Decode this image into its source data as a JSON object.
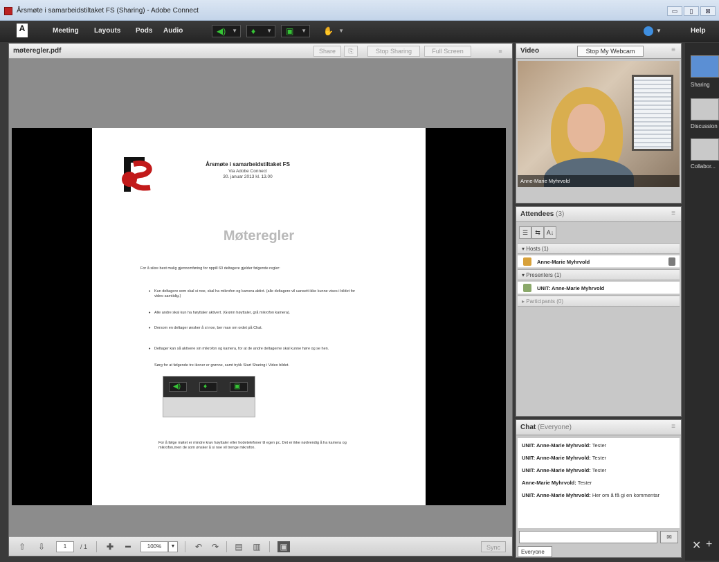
{
  "window": {
    "title": "Årsmøte i samarbeidstiltaket FS (Sharing) - Adobe Connect",
    "btn_min": "▭",
    "btn_max": "▯",
    "btn_close": "⊠"
  },
  "menu": {
    "logo": "A",
    "items": [
      "Meeting",
      "Layouts",
      "Pods",
      "Audio"
    ],
    "help": "Help"
  },
  "share_pod": {
    "title": "møteregler.pdf",
    "header_buttons": [
      "Share",
      "⎘",
      "Stop Sharing",
      "Full Screen",
      "≡"
    ],
    "document": {
      "title": "Årsmøte i samarbeidstiltaket FS",
      "subtitle": "Via Adobe Connect",
      "date": "30. januar 2013 kl. 13.00",
      "heading": "Møteregler",
      "intro": "For å sikre best mulig gjennomføring for nppill 60 deltagere gjelder følgende regler:",
      "rules": [
        "Kun deltagere som skal si noe, skal ha mikrofon og kamera aktivt. (alle deltagere vil uansett ikke kunne vises i bildet for video samtidig.)",
        "Alle andre skal kun ha høyttaler aktivert. (Grønn høyttaler, grå mikrofon kamera).",
        "Dersom en deltager ønsker å si noe, ber man om ordet på Chat.",
        "Deltager kan så aktivere sin mikrofon og kamera, for at de andre deltagerne skal kunne høre og se hen.",
        "Sørg for at følgende tre ikoner er grønne, samt trykk Start Sharing i Video bildet."
      ],
      "footer": "For å følge møtet er mindre krav høyttaler eller hodetelefoner til egen pc. Det er ikke nødvendig å ha kamera og mikrofon,men de som ønsker å si noe vil trenge mikrofon."
    },
    "toolbar": {
      "page": "1",
      "page_total": "/ 1",
      "zoom": "100%",
      "sync": "Sync"
    }
  },
  "video_pod": {
    "title": "Video",
    "stop_webcam": "Stop My Webcam",
    "participant_name": "Anne-Marie Myhrvold"
  },
  "attendees_pod": {
    "title": "Attendees",
    "count": "(3)",
    "sections": [
      {
        "label": "Hosts (1)",
        "people": [
          "Anne-Marie Myhrvold"
        ]
      },
      {
        "label": "Presenters (1)",
        "people": [
          "UNIT: Anne-Marie Myhrvold"
        ]
      },
      {
        "label": "Participants (0)",
        "people": []
      }
    ]
  },
  "chat_pod": {
    "title": "Chat",
    "audience": "(Everyone)",
    "messages": [
      {
        "author": "UNIT: Anne-Marie Myhrvold:",
        "text": "Tester"
      },
      {
        "author": "UNIT: Anne-Marie Myhrvold:",
        "text": "Tester"
      },
      {
        "author": "UNIT: Anne-Marie Myhrvold:",
        "text": "Tester"
      },
      {
        "author": "Anne-Marie Myhrvold:",
        "text": "Tester"
      },
      {
        "author": "UNIT: Anne-Marie Myhrvold:",
        "text": "Her om å få gi en kommentar"
      }
    ],
    "send_to": "Everyone"
  },
  "layouts": {
    "items": [
      "Sharing",
      "Discussion",
      "Collabor..."
    ]
  }
}
